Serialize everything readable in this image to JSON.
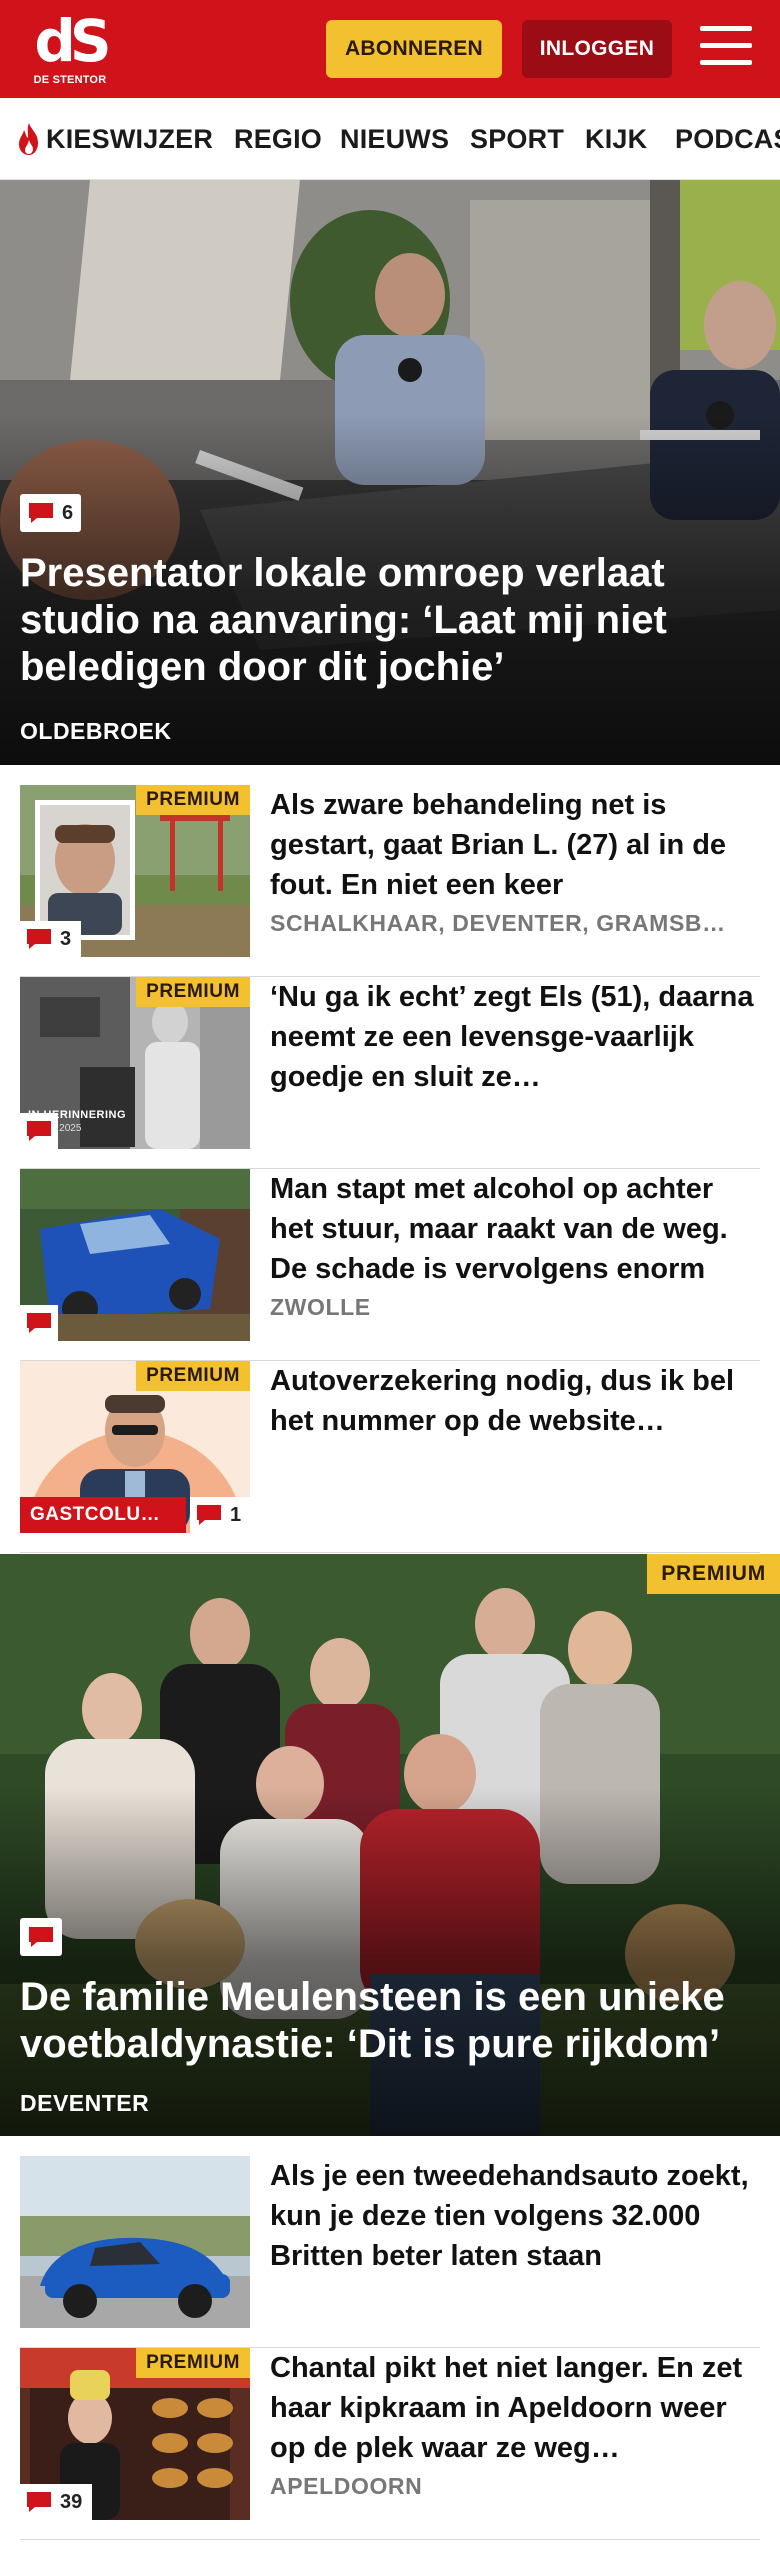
{
  "header": {
    "logo_mark": "dS",
    "logo_sub": "DE STENTOR",
    "subscribe_label": "ABONNEREN",
    "login_label": "INLOGGEN",
    "menu_icon": "hamburger-icon",
    "brand_color": "#d0121b",
    "accent_color": "#f3c02f"
  },
  "nav": {
    "items": [
      {
        "label": "KIESWIJZER",
        "icon": "flame-icon"
      },
      {
        "label": "REGIO"
      },
      {
        "label": "NIEUWS"
      },
      {
        "label": "SPORT"
      },
      {
        "label": "KIJK"
      },
      {
        "label": "PODCAS"
      }
    ]
  },
  "hero": {
    "comment_count": "6",
    "title": "Presentator lokale omroep verlaat studio na aanvaring: ‘Laat mij niet beledigen door dit jochie’",
    "location": "OLDEBROEK"
  },
  "articles": [
    {
      "premium": "PREMIUM",
      "comment_count": "3",
      "title": "Als zware behandeling net is gestart, gaat Brian L. (27) al in de fout. En niet een keer",
      "location": "SCHALKHAAR, DEVENTER, GRAMSB…"
    },
    {
      "premium": "PREMIUM",
      "comment_count": "",
      "photo_caption": "IN HERINNERING",
      "photo_years": "1974 - 2025",
      "title": "‘Nu ga ik echt’ zegt Els (51), daarna neemt ze een levensge-vaarlijk goedje en sluit ze…",
      "location": ""
    },
    {
      "premium": "",
      "comment_count": "",
      "title": "Man stapt met alcohol op achter het stuur, maar raakt van de weg. De schade is vervolgens enorm",
      "location": "ZWOLLE"
    },
    {
      "premium": "PREMIUM",
      "comment_count": "1",
      "column_label": "GASTCOLU…",
      "title": "Autoverzekering nodig, dus ik bel het nummer op de website…",
      "location": ""
    }
  ],
  "family": {
    "premium": "PREMIUM",
    "comment_count": "",
    "title": "De familie Meulensteen is een unieke voetbaldynastie: ‘Dit is pure rijkdom’",
    "location": "DEVENTER"
  },
  "articles2": [
    {
      "premium": "",
      "comment_count": "",
      "title": "Als je een tweedehandsauto zoekt, kun je deze tien volgens 32.000 Britten beter laten staan",
      "location": ""
    },
    {
      "premium": "PREMIUM",
      "comment_count": "39",
      "title": "Chantal pikt het niet langer. En zet haar kipkraam in Apeldoorn weer op de plek waar ze weg…",
      "location": "APELDOORN"
    }
  ]
}
